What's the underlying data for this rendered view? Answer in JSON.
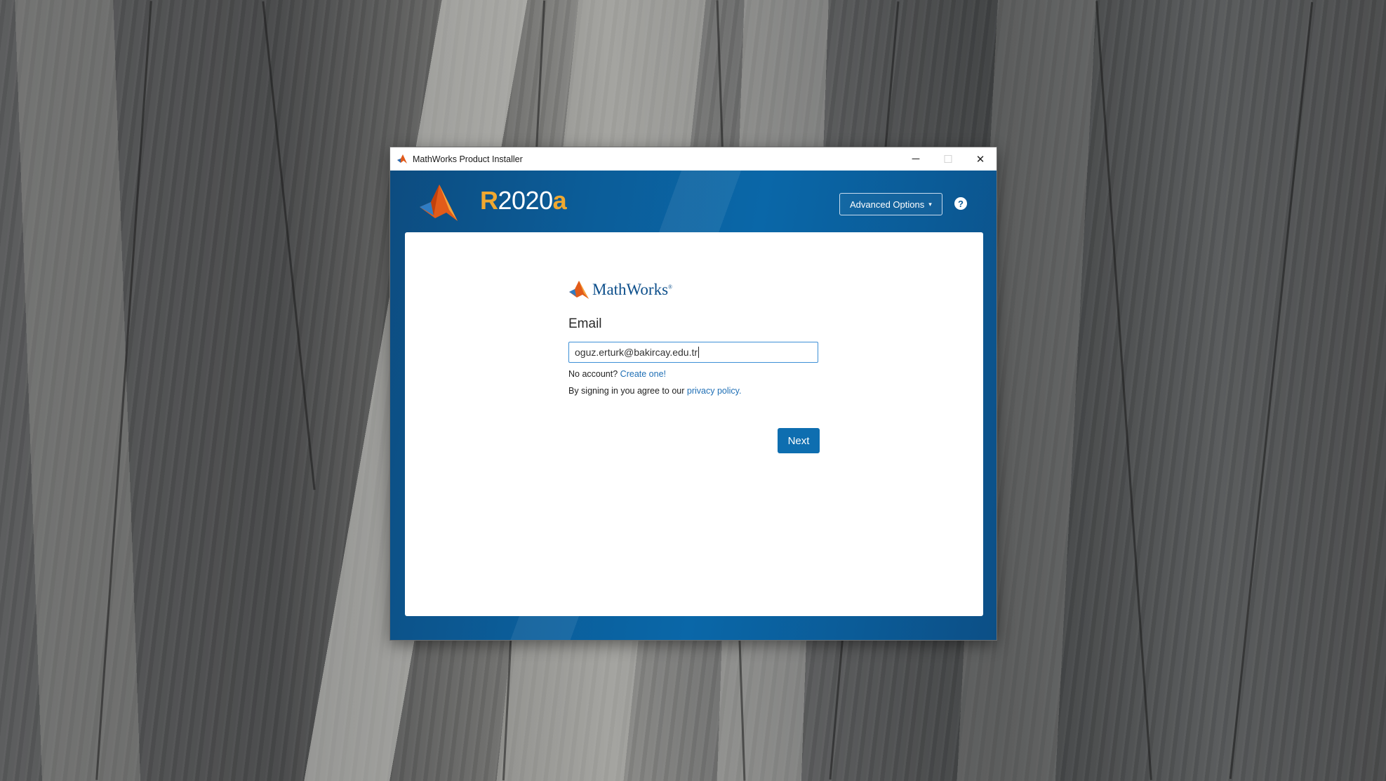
{
  "window": {
    "title": "MathWorks Product Installer",
    "icon": "matlab-membrane-icon",
    "controls": {
      "minimize": "─",
      "maximize": "☐",
      "close": "✕"
    }
  },
  "header": {
    "release_prefix": "R",
    "release_year": "2020",
    "release_suffix": "a",
    "advanced_options_label": "Advanced Options",
    "advanced_options_caret": "▾",
    "help_label": "?"
  },
  "form": {
    "brand_name": "MathWorks",
    "brand_reg": "®",
    "email_label": "Email",
    "email_value": "oguz.erturk@bakircay.edu.tr",
    "no_account_text": "No account?",
    "create_link": "Create one!",
    "agree_text": "By signing in you agree to our",
    "privacy_link": "privacy policy.",
    "next_label": "Next"
  },
  "colors": {
    "accent_blue": "#0e6eb0",
    "release_orange": "#f0a830",
    "link_blue": "#1f6fb5"
  }
}
